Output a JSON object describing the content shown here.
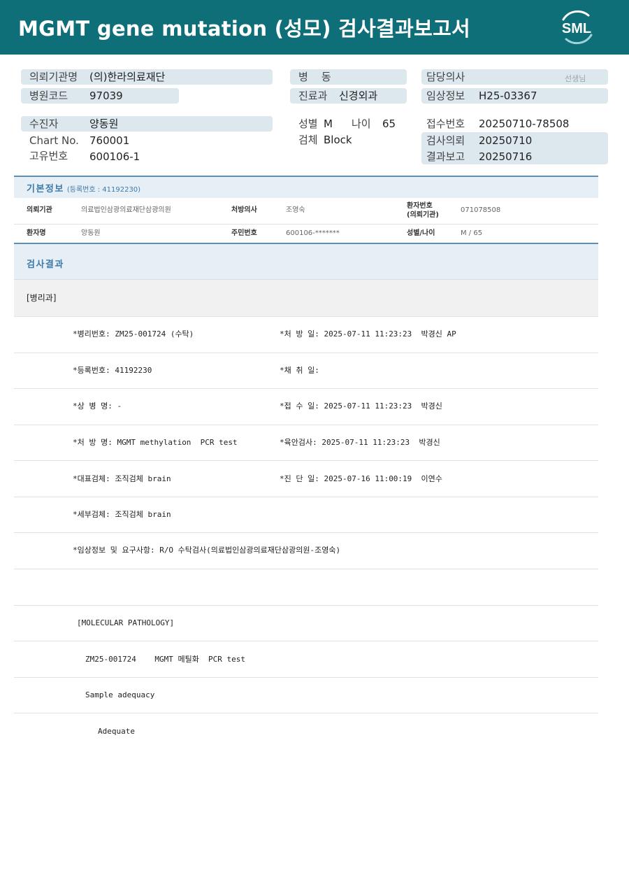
{
  "header": {
    "title": "MGMT gene mutation (성모) 검사결과보고서",
    "logo_text": "SML",
    "bg_color": "#0f6f78"
  },
  "request_info": {
    "institution_label": "의뢰기관명",
    "institution_value": "(의)한라의료재단",
    "hospital_code_label": "병원코드",
    "hospital_code_value": "97039",
    "ward_label": "병    동",
    "ward_value": "",
    "department_label": "진료과",
    "department_value": "신경외과",
    "doctor_label": "담당의사",
    "doctor_suffix": "선생님",
    "clinical_info_label": "임상정보",
    "clinical_info_value": "H25-03367",
    "patient_label": "수진자",
    "patient_value": "양동원",
    "chart_label": "Chart No.",
    "chart_value": "760001",
    "unique_id_label": "고유번호",
    "unique_id_value": "600106-1",
    "sex_label": "성별",
    "sex_value": "M",
    "age_label": "나이",
    "age_value": "65",
    "specimen_label": "검체",
    "specimen_value": "Block",
    "receipt_label": "접수번호",
    "receipt_value": "20250710-78508",
    "request_date_label": "검사의뢰",
    "request_date_value": "20250710",
    "report_date_label": "결과보고",
    "report_date_value": "20250716"
  },
  "basic_info": {
    "title": "기본정보",
    "reg_no_label": "(등록번호 : 41192230)",
    "institution_label": "의뢰기관",
    "institution_value": "의료법인삼광의료재단삼광의원",
    "prescriber_label": "처방의사",
    "prescriber_value": "조영숙",
    "patient_no_label_1": "환자번호",
    "patient_no_label_2": "(의뢰기관)",
    "patient_no_value": "071078508",
    "patient_name_label": "환자명",
    "patient_name_value": "양동원",
    "resident_no_label": "주민번호",
    "resident_no_value": "600106-*******",
    "sex_age_label": "성별/나이",
    "sex_age_value": "M / 65"
  },
  "results": {
    "title": "검사결과",
    "dept": "[병리과]",
    "rows": [
      {
        "left": "*병리번호: ZM25-001724 (수탁)",
        "right": "*처 방 일: 2025-07-11 11:23:23  박경신 AP"
      },
      {
        "left": "*등록번호: 41192230",
        "right": "*채 취 일:"
      },
      {
        "left": "*상 병 명: -",
        "right": "*접 수 일: 2025-07-11 11:23:23  박경신"
      },
      {
        "left": "*처 방 명: MGMT methylation  PCR test",
        "right": "*육안검사: 2025-07-11 11:23:23  박경신"
      },
      {
        "left": "*대표검체: 조직검체 brain",
        "right": "*진 단 일: 2025-07-16 11:00:19  이연수"
      },
      {
        "left": "*세부검체: 조직검체 brain",
        "right": ""
      },
      {
        "left": "*임상정보 및 요구사항: R/O 수탁검사(의료법인삼광의료재단삼광의원-조영숙)",
        "right": ""
      }
    ],
    "molecular_header": "[MOLECULAR PATHOLOGY]",
    "molecular_line": "ZM25-001724    MGMT 메틸화  PCR test",
    "sample_label": "Sample adequacy",
    "sample_value": "Adequate"
  }
}
